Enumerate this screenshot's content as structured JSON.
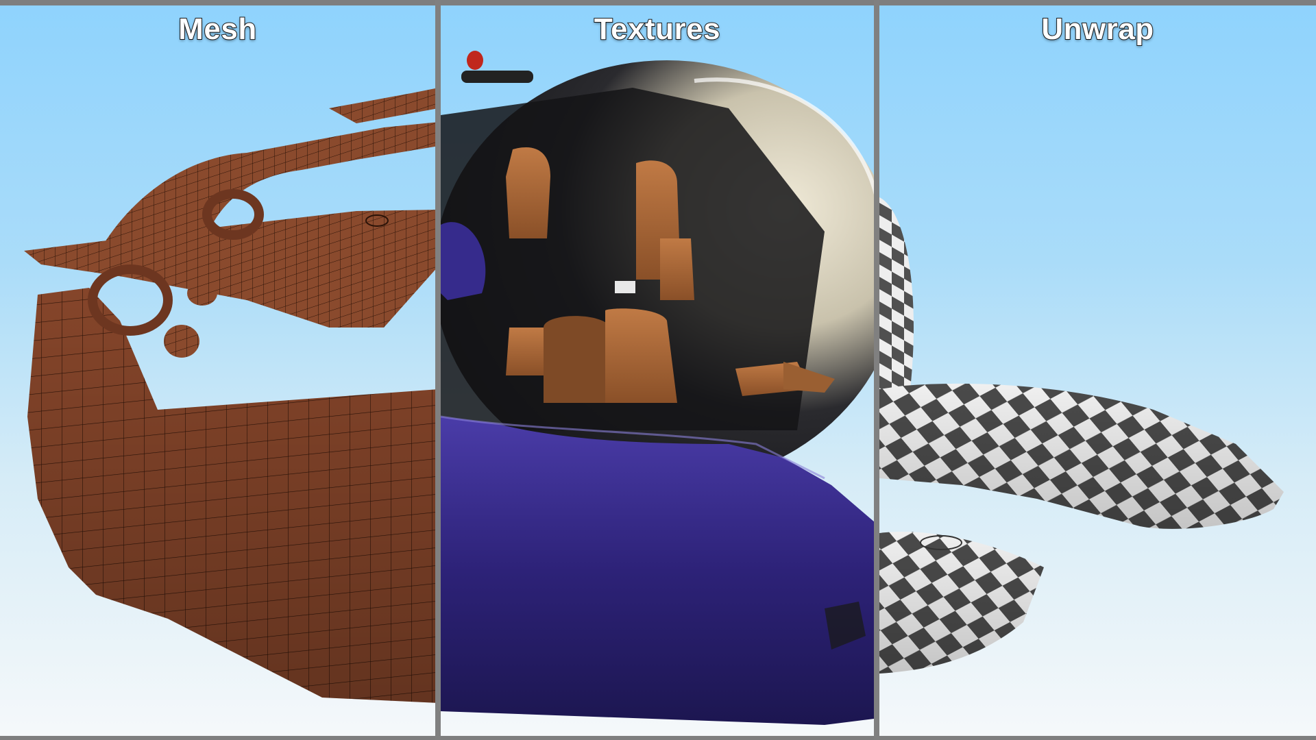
{
  "panels": [
    {
      "title": "Mesh"
    },
    {
      "title": "Textures"
    },
    {
      "title": "Unwrap"
    }
  ],
  "colors": {
    "sky_top": "#8fd3fd",
    "sky_bottom": "#f5f8fa",
    "mesh_brown": "#85452a",
    "wire_line": "#2a1207",
    "hull_purple": "#2d2278",
    "leather": "#a8683a",
    "checker_dark": "#4a4a4a",
    "checker_light": "#f0f0f0",
    "frame_gray": "#808080"
  }
}
